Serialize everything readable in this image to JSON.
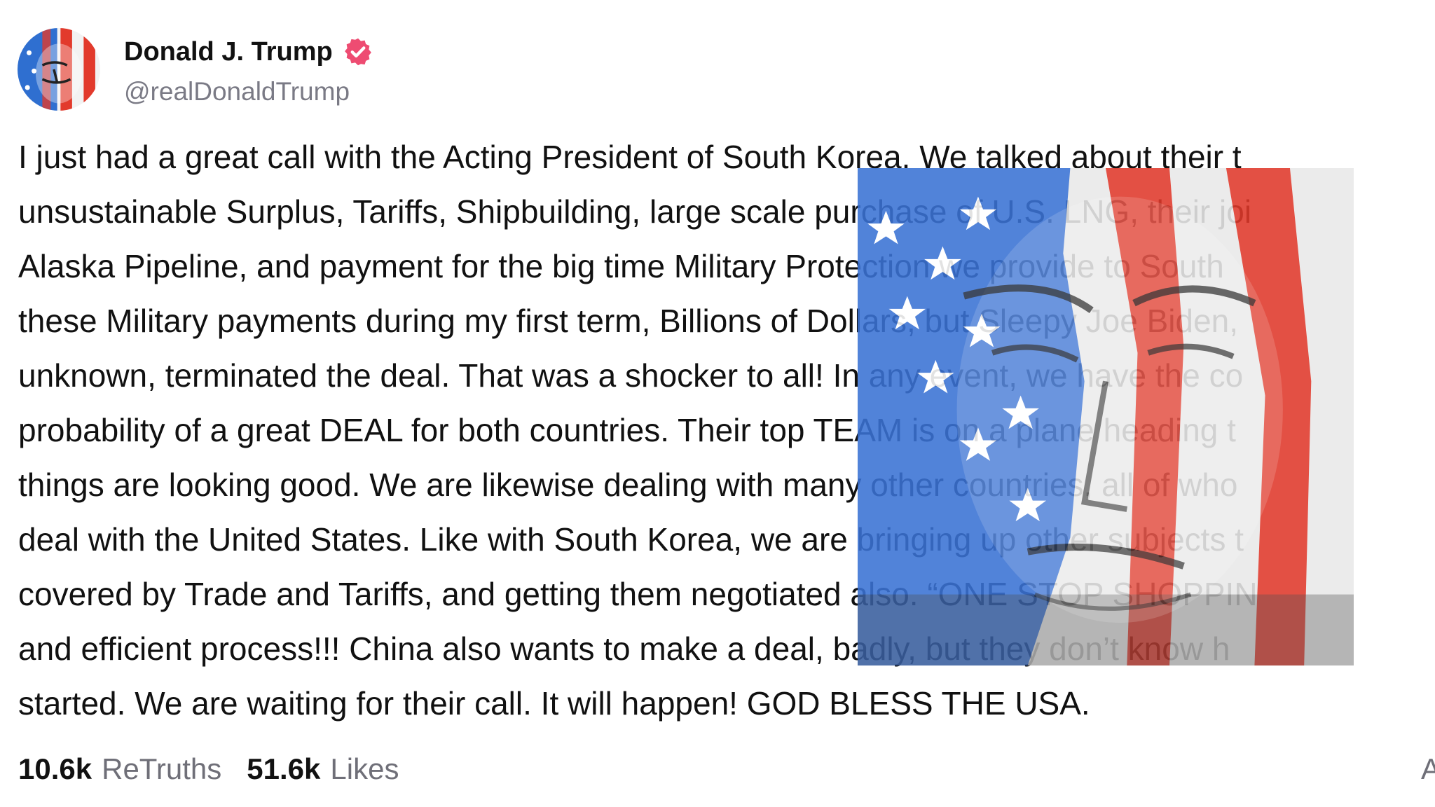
{
  "author": {
    "display_name": "Donald J. Trump",
    "handle": "@realDonaldTrump",
    "verified": true,
    "verified_color": "#ee4c72"
  },
  "post": {
    "lines": [
      "I just had a great call with the Acting President of South Korea. We talked about their t",
      "unsustainable Surplus, Tariffs, Shipbuilding, large scale purchase of U.S. LNG, their joi",
      "Alaska Pipeline, and payment for the big time Military Protection we provide to South",
      "these Military payments during my first term, Billions of Dollars, but Sleepy Joe Biden,",
      "unknown, terminated the deal. That was a shocker to all! In any event, we have the co",
      "probability of a great DEAL for both countries. Their top TEAM is on a plane heading t",
      "things are looking good. We are likewise dealing with many other countries, all of who",
      "deal with the United States. Like with South Korea, we are bringing up other subjects t",
      "covered by Trade and Tariffs, and getting them negotiated also. “ONE STOP SHOPPIN",
      "and efficient process!!! China also wants to make a deal, badly, but they don’t know h",
      "started. We are waiting for their call. It will happen! GOD BLESS THE USA."
    ]
  },
  "stats": {
    "retruths_count": "10.6k",
    "retruths_label": "ReTruths",
    "likes_count": "51.6k",
    "likes_label": "Likes",
    "right_fragment": "A"
  },
  "icons": {
    "avatar": "flag-painted-portrait-avatar",
    "verified": "verified-badge-icon",
    "overlay_image": "flag-painted-portrait-image"
  },
  "colors": {
    "text": "#111111",
    "muted": "#7a7a85",
    "flag_red": "#e23a2c",
    "flag_blue": "#2f6fd0"
  }
}
